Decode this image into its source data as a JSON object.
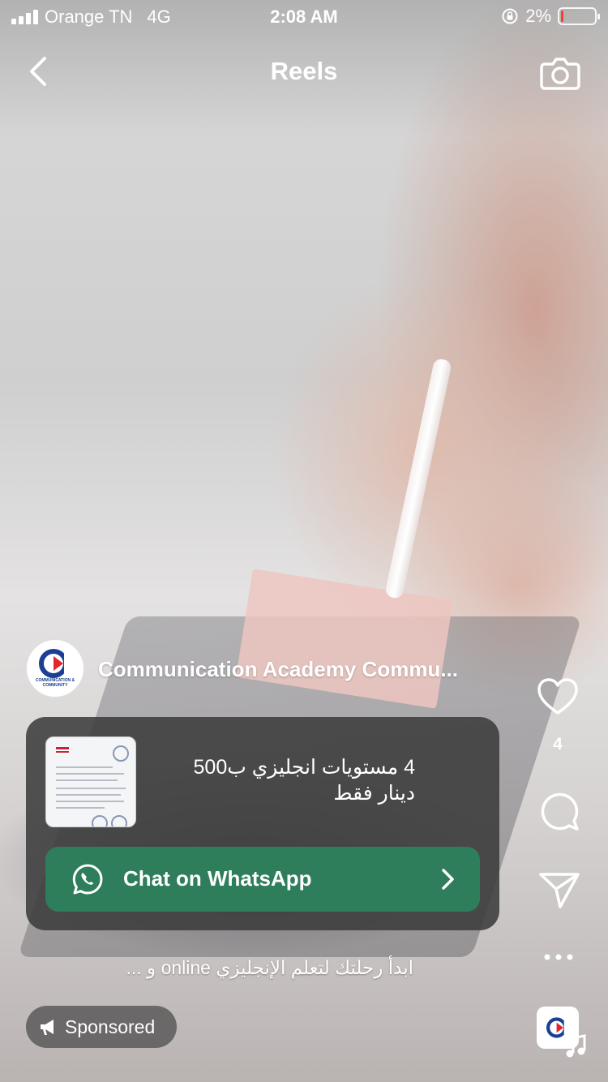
{
  "status_bar": {
    "carrier": "Orange TN",
    "network": "4G",
    "time": "2:08 AM",
    "battery_percent": "2%",
    "battery_level": 0.02,
    "battery_color": "#ff3b30"
  },
  "header": {
    "title": "Reels",
    "back_icon": "chevron-left-icon",
    "camera_icon": "camera-icon"
  },
  "account": {
    "name": "Communication Academy Commu...",
    "avatar_text_top": "COMMUNICATION &",
    "avatar_text_bottom": "COMMUNITY"
  },
  "ad": {
    "headline": "4 مستويات انجليزي ب500 دينار فقط",
    "cta_label": "Chat on WhatsApp",
    "cta_color": "#2e7d5b",
    "cta_icon": "whatsapp-icon"
  },
  "caption": "ابدأ رحلتك لتعلم الإنجليزي online و ...",
  "sponsored_label": "Sponsored",
  "rail": {
    "like_count": "4",
    "icons": [
      "heart-icon",
      "comment-icon",
      "send-icon",
      "more-icon",
      "music-note-icon"
    ]
  },
  "colors": {
    "brand_red": "#e3262e",
    "brand_blue": "#1c3f94"
  }
}
